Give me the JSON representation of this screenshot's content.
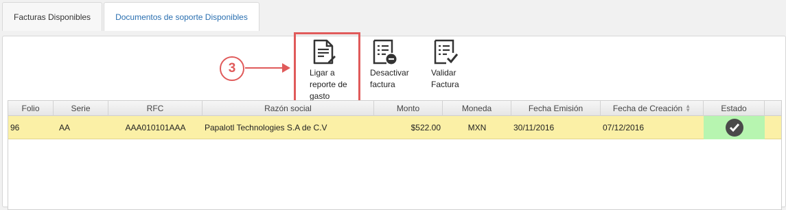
{
  "tabs": [
    {
      "label": "Facturas Disponibles",
      "active": true
    },
    {
      "label": "Documentos de soporte Disponibles",
      "active": false
    }
  ],
  "toolbar": {
    "link_report": {
      "line1": "Ligar a",
      "line2": "reporte de",
      "line3": "gasto",
      "icon": "document-edit-icon"
    },
    "deactivate": {
      "line1": "Desactivar",
      "line2": "factura",
      "icon": "document-minus-icon"
    },
    "validate": {
      "line1": "Validar",
      "line2": "Factura",
      "icon": "document-check-icon"
    }
  },
  "annotation": {
    "step": "3",
    "color": "#e05a5a"
  },
  "grid": {
    "columns": [
      "Folio",
      "Serie",
      "RFC",
      "Razón social",
      "Monto",
      "Moneda",
      "Fecha Emisión",
      "Fecha de Creación",
      "Estado"
    ],
    "rows": [
      {
        "folio": "96",
        "serie": "AA",
        "rfc": "AAA010101AAA",
        "razon_social": "Papalotl Technologies S.A de C.V",
        "monto": "$522.00",
        "moneda": "MXN",
        "fecha_emision": "30/11/2016",
        "fecha_creacion": "07/12/2016",
        "estado_icon": "checkmark-icon"
      }
    ]
  },
  "colors": {
    "row_highlight": "#fbf0a6",
    "status_ok": "#b7f5b0",
    "tab_link": "#2a6fb0"
  }
}
